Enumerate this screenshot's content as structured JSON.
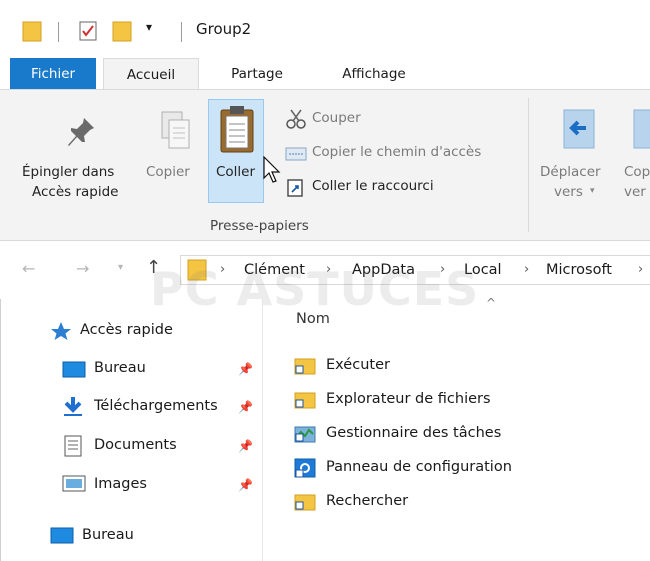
{
  "window": {
    "title": "Group2"
  },
  "tabs": {
    "file": "Fichier",
    "home": "Accueil",
    "share": "Partage",
    "view": "Affichage"
  },
  "ribbon": {
    "pin_line1": "Épingler dans",
    "pin_line2": "Accès rapide",
    "copy": "Copier",
    "paste": "Coller",
    "cut": "Couper",
    "copy_path": "Copier le chemin d'accès",
    "paste_shortcut": "Coller le raccourci",
    "clipboard_group": "Presse-papiers",
    "move_line1": "Déplacer",
    "move_line2": "vers",
    "copy_to_line1": "Cop",
    "copy_to_line2": "ver"
  },
  "address": {
    "crumbs": [
      "Clément",
      "AppData",
      "Local",
      "Microsoft"
    ]
  },
  "watermark": "PC ASTUCES",
  "nav": {
    "quick_access": "Accès rapide",
    "items": [
      "Bureau",
      "Téléchargements",
      "Documents",
      "Images"
    ],
    "desktop": "Bureau"
  },
  "files": {
    "column_name": "Nom",
    "items": [
      "Exécuter",
      "Explorateur de fichiers",
      "Gestionnaire des tâches",
      "Panneau de configuration",
      "Rechercher"
    ]
  },
  "colors": {
    "accent": "#1979ca",
    "selection": "#cce4f7",
    "folder": "#f4c542"
  }
}
